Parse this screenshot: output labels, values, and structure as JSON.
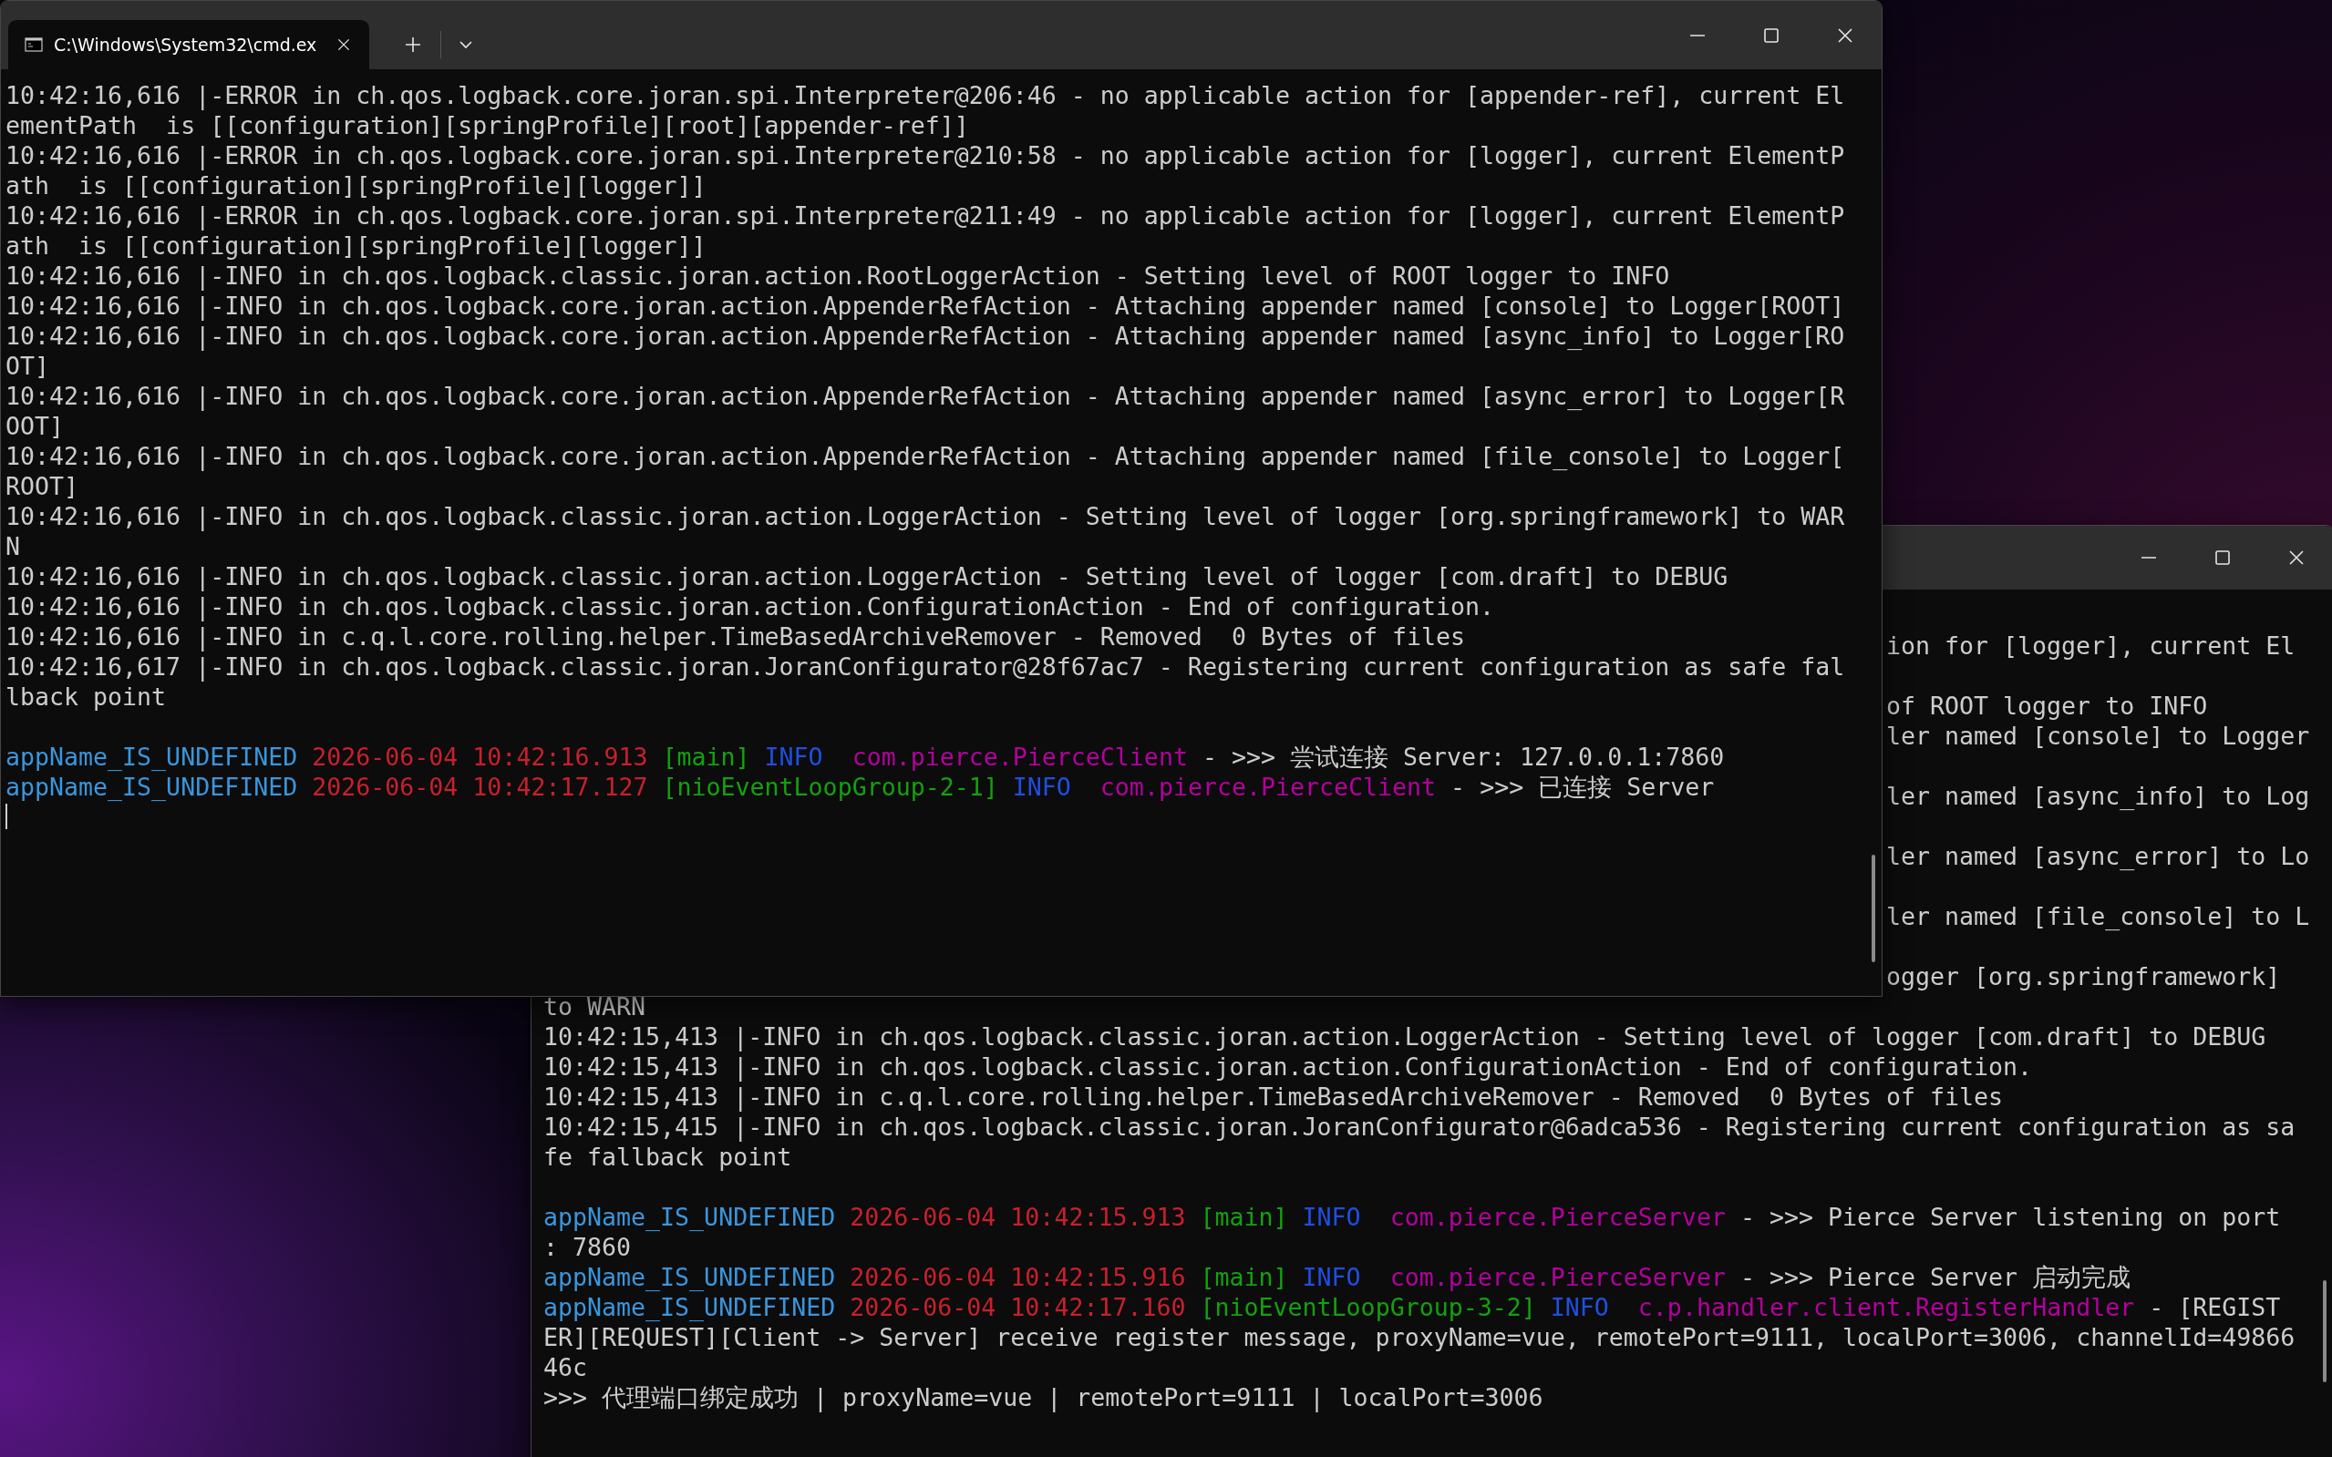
{
  "windows": [
    {
      "tabs": [
        {
          "title": "C:\\Windows\\System32\\cmd.ex"
        }
      ],
      "cursor": true,
      "lines": [
        {
          "kind": "text",
          "text": "10:42:16,616 |-ERROR in ch.qos.logback.core.joran.spi.Interpreter@206:46 - no applicable action for [appender-ref], current ElementPath  is [[configuration][springProfile][root][appender-ref]]"
        },
        {
          "kind": "text",
          "text": "10:42:16,616 |-ERROR in ch.qos.logback.core.joran.spi.Interpreter@210:58 - no applicable action for [logger], current ElementPath  is [[configuration][springProfile][logger]]"
        },
        {
          "kind": "text",
          "text": "10:42:16,616 |-ERROR in ch.qos.logback.core.joran.spi.Interpreter@211:49 - no applicable action for [logger], current ElementPath  is [[configuration][springProfile][logger]]"
        },
        {
          "kind": "text",
          "text": "10:42:16,616 |-INFO in ch.qos.logback.classic.joran.action.RootLoggerAction - Setting level of ROOT logger to INFO"
        },
        {
          "kind": "text",
          "text": "10:42:16,616 |-INFO in ch.qos.logback.core.joran.action.AppenderRefAction - Attaching appender named [console] to Logger[ROOT]"
        },
        {
          "kind": "text",
          "text": "10:42:16,616 |-INFO in ch.qos.logback.core.joran.action.AppenderRefAction - Attaching appender named [async_info] to Logger[ROOT]"
        },
        {
          "kind": "text",
          "text": "10:42:16,616 |-INFO in ch.qos.logback.core.joran.action.AppenderRefAction - Attaching appender named [async_error] to Logger[ROOT]"
        },
        {
          "kind": "text",
          "text": "10:42:16,616 |-INFO in ch.qos.logback.core.joran.action.AppenderRefAction - Attaching appender named [file_console] to Logger[ROOT]"
        },
        {
          "kind": "text",
          "text": "10:42:16,616 |-INFO in ch.qos.logback.classic.joran.action.LoggerAction - Setting level of logger [org.springframework] to WARN"
        },
        {
          "kind": "text",
          "text": "10:42:16,616 |-INFO in ch.qos.logback.classic.joran.action.LoggerAction - Setting level of logger [com.draft] to DEBUG"
        },
        {
          "kind": "text",
          "text": "10:42:16,616 |-INFO in ch.qos.logback.classic.joran.action.ConfigurationAction - End of configuration."
        },
        {
          "kind": "text",
          "text": "10:42:16,616 |-INFO in c.q.l.core.rolling.helper.TimeBasedArchiveRemover - Removed  0 Bytes of files"
        },
        {
          "kind": "text",
          "text": "10:42:16,617 |-INFO in ch.qos.logback.classic.joran.JoranConfigurator@28f67ac7 - Registering current configuration as safe fallback point"
        },
        {
          "kind": "blank"
        },
        {
          "kind": "colored",
          "segments": [
            {
              "text": "appName_IS_UNDEFINED ",
              "color": "#3a96dd"
            },
            {
              "text": "2026-06-04 10:42:16.913 ",
              "color": "#c8202c"
            },
            {
              "text": "[main] ",
              "color": "#13a10e"
            },
            {
              "text": "INFO  ",
              "color": "#1f4fe0"
            },
            {
              "text": "com.pierce.PierceClient",
              "color": "#b4009e"
            },
            {
              "text": " - >>> 尝试连接 Server: 127.0.0.1:7860",
              "color": "#cccccc"
            }
          ]
        },
        {
          "kind": "colored",
          "segments": [
            {
              "text": "appName_IS_UNDEFINED ",
              "color": "#3a96dd"
            },
            {
              "text": "2026-06-04 10:42:17.127 ",
              "color": "#c8202c"
            },
            {
              "text": "[nioEventLoopGroup-2-1] ",
              "color": "#13a10e"
            },
            {
              "text": "INFO  ",
              "color": "#1f4fe0"
            },
            {
              "text": "com.pierce.PierceClient",
              "color": "#b4009e"
            },
            {
              "text": " - >>> 已连接 Server",
              "color": "#cccccc"
            }
          ]
        }
      ]
    },
    {
      "lines": [
        {
          "kind": "fragment",
          "text": "ion for [logger], current El",
          "continues": true
        },
        {
          "kind": "fragment",
          "text": "of ROOT logger to INFO",
          "continues": false
        },
        {
          "kind": "fragment",
          "text": "ler named [console] to Logger",
          "continues": true
        },
        {
          "kind": "fragment",
          "text": "ler named [async_info] to Log",
          "continues": true
        },
        {
          "kind": "fragment",
          "text": "ler named [async_error] to Lo",
          "continues": true
        },
        {
          "kind": "fragment",
          "text": "ler named [file_console] to L",
          "continues": true
        },
        {
          "kind": "fragment",
          "text": "ogger [org.springframework]",
          "continues": false
        },
        {
          "kind": "text",
          "text": "to WARN"
        },
        {
          "kind": "text",
          "text": "10:42:15,413 |-INFO in ch.qos.logback.classic.joran.action.LoggerAction - Setting level of logger [com.draft] to DEBUG"
        },
        {
          "kind": "text",
          "text": "10:42:15,413 |-INFO in ch.qos.logback.classic.joran.action.ConfigurationAction - End of configuration."
        },
        {
          "kind": "text",
          "text": "10:42:15,413 |-INFO in c.q.l.core.rolling.helper.TimeBasedArchiveRemover - Removed  0 Bytes of files"
        },
        {
          "kind": "text",
          "text": "10:42:15,415 |-INFO in ch.qos.logback.classic.joran.JoranConfigurator@6adca536 - Registering current configuration as safe fallback point"
        },
        {
          "kind": "blank"
        },
        {
          "kind": "colored",
          "segments": [
            {
              "text": "appName_IS_UNDEFINED ",
              "color": "#3a96dd"
            },
            {
              "text": "2026-06-04 10:42:15.913 ",
              "color": "#c8202c"
            },
            {
              "text": "[main] ",
              "color": "#13a10e"
            },
            {
              "text": "INFO  ",
              "color": "#1f4fe0"
            },
            {
              "text": "com.pierce.PierceServer",
              "color": "#b4009e"
            },
            {
              "text": " - >>> Pierce Server listening on port: 7860",
              "color": "#cccccc"
            }
          ]
        },
        {
          "kind": "colored",
          "segments": [
            {
              "text": "appName_IS_UNDEFINED ",
              "color": "#3a96dd"
            },
            {
              "text": "2026-06-04 10:42:15.916 ",
              "color": "#c8202c"
            },
            {
              "text": "[main] ",
              "color": "#13a10e"
            },
            {
              "text": "INFO  ",
              "color": "#1f4fe0"
            },
            {
              "text": "com.pierce.PierceServer",
              "color": "#b4009e"
            },
            {
              "text": " - >>> Pierce Server 启动完成",
              "color": "#cccccc"
            }
          ]
        },
        {
          "kind": "colored",
          "segments": [
            {
              "text": "appName_IS_UNDEFINED ",
              "color": "#3a96dd"
            },
            {
              "text": "2026-06-04 10:42:17.160 ",
              "color": "#c8202c"
            },
            {
              "text": "[nioEventLoopGroup-3-2] ",
              "color": "#13a10e"
            },
            {
              "text": "INFO  ",
              "color": "#1f4fe0"
            },
            {
              "text": "c.p.handler.client.RegisterHandler",
              "color": "#b4009e"
            },
            {
              "text": " - [REGISTER][REQUEST][Client -> Server] receive register message, proxyName=vue, remotePort=9111, localPort=3006, channelId=4986646c",
              "color": "#cccccc"
            }
          ]
        },
        {
          "kind": "text",
          "text": ">>> 代理端口绑定成功 | proxyName=vue | remotePort=9111 | localPort=3006"
        }
      ]
    }
  ]
}
